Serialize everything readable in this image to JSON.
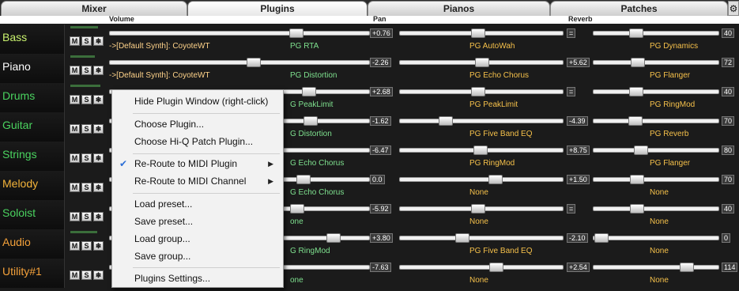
{
  "tabs": {
    "mixer": "Mixer",
    "plugins": "Plugins",
    "pianos": "Pianos",
    "patches": "Patches"
  },
  "gear_icon": "⚙",
  "headers": {
    "volume": "Volume",
    "pan": "Pan",
    "reverb": "Reverb"
  },
  "buttons": {
    "m": "M",
    "s": "S",
    "edit_icon": "❄"
  },
  "rows": [
    {
      "name": "Bass",
      "synth": "->[Default Synth]: CoyoteWT",
      "vol": "+0.76",
      "rev_label": "=",
      "reverb_val": "40",
      "p1": "PG RTA",
      "p2": "PG AutoWah",
      "p3": "PG Dynamics"
    },
    {
      "name": "Piano",
      "synth": "->[Default Synth]: CoyoteWT",
      "vol": "-2.26",
      "rev_label": "+5.62",
      "reverb_val": "72",
      "p1": "PG Distortion",
      "p2": "PG Echo Chorus",
      "p3": "PG Flanger"
    },
    {
      "name": "Drums",
      "synth": "",
      "vol": "+2.68",
      "rev_label": "=",
      "reverb_val": "40",
      "p1": "G PeakLimit",
      "p2": "PG PeakLimit",
      "p3": "PG RingMod"
    },
    {
      "name": "Guitar",
      "synth": "",
      "vol": "-1.62",
      "rev_label": "-4.39",
      "reverb_val": "70",
      "p1": "G Distortion",
      "p2": "PG Five Band EQ",
      "p3": "PG Reverb"
    },
    {
      "name": "Strings",
      "synth": "",
      "vol": "-6.47",
      "rev_label": "+8.75",
      "reverb_val": "80",
      "p1": "G Echo Chorus",
      "p2": "PG RingMod",
      "p3": "PG Flanger"
    },
    {
      "name": "Melody",
      "synth": "",
      "vol": "0.0",
      "rev_label": "+1.50",
      "reverb_val": "70",
      "p1": "G Echo Chorus",
      "p2": "None",
      "p3": "None"
    },
    {
      "name": "Soloist",
      "synth": "",
      "vol": "-5.92",
      "rev_label": "=",
      "reverb_val": "40",
      "p1": "one",
      "p2": "None",
      "p3": "None"
    },
    {
      "name": "Audio",
      "synth": "",
      "vol": "+3.80",
      "rev_label": "-2.10",
      "reverb_val": "0",
      "p1": "G RingMod",
      "p2": "PG Five Band EQ",
      "p3": "None"
    },
    {
      "name": "Utility#1",
      "synth": "",
      "vol": "-7.63",
      "rev_label": "+2.54",
      "reverb_val": "114",
      "p1": "one",
      "p2": "None",
      "p3": "None"
    }
  ],
  "menu": {
    "hide": "Hide Plugin Window (right-click)",
    "choose": "Choose Plugin...",
    "choose_hq": "Choose Hi-Q Patch Plugin...",
    "reroute_plugin": "Re-Route to MIDI Plugin",
    "reroute_channel": "Re-Route to MIDI Channel",
    "load_preset": "Load preset...",
    "save_preset": "Save preset...",
    "load_group": "Load group...",
    "save_group": "Save group...",
    "settings": "Plugins Settings...",
    "check_icon": "✔",
    "submenu_arrow": "▶"
  }
}
